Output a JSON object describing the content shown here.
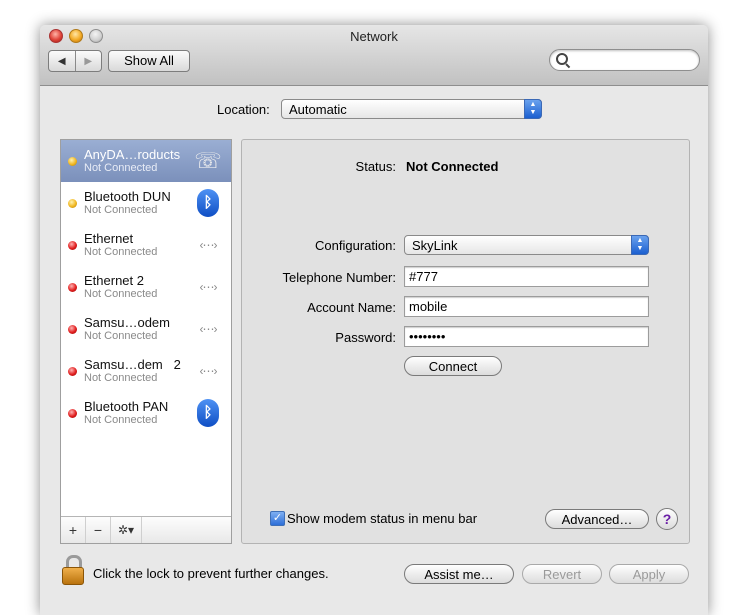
{
  "window": {
    "title": "Network"
  },
  "toolbar": {
    "back": "◀",
    "forward": "▶",
    "show_all": "Show All",
    "search_value": ""
  },
  "location": {
    "label": "Location:",
    "value": "Automatic"
  },
  "services": [
    {
      "name": "AnyDA…roducts",
      "status": "Not Connected",
      "indicator": "yellow",
      "icon": "phone-modem-icon",
      "selected": true
    },
    {
      "name": "Bluetooth DUN",
      "status": "Not Connected",
      "indicator": "yellow",
      "icon": "bluetooth-icon"
    },
    {
      "name": "Ethernet",
      "status": "Not Connected",
      "indicator": "red",
      "icon": "ethernet-icon"
    },
    {
      "name": "Ethernet 2",
      "status": "Not Connected",
      "indicator": "red",
      "icon": "ethernet-icon"
    },
    {
      "name": "Samsu…odem",
      "status": "Not Connected",
      "indicator": "red",
      "icon": "ethernet-icon"
    },
    {
      "name": "Samsu…dem   2",
      "status": "Not Connected",
      "indicator": "red",
      "icon": "ethernet-icon"
    },
    {
      "name": "Bluetooth PAN",
      "status": "Not Connected",
      "indicator": "red",
      "icon": "bluetooth-icon"
    }
  ],
  "sidebar_tools": {
    "add": "+",
    "remove": "−",
    "action": "✲▾"
  },
  "detail": {
    "status_label": "Status:",
    "status_value": "Not Connected",
    "configuration_label": "Configuration:",
    "configuration_value": "SkyLink",
    "telephone_label": "Telephone Number:",
    "telephone_value": "#777",
    "account_label": "Account Name:",
    "account_value": "mobile",
    "password_label": "Password:",
    "password_value": "••••••••",
    "connect_label": "Connect",
    "show_modem_label": "Show modem status in menu bar",
    "show_modem_checked": true,
    "advanced_label": "Advanced…",
    "help_label": "?"
  },
  "footer": {
    "lock_text": "Click the lock to prevent further changes.",
    "assist_label": "Assist me…",
    "revert_label": "Revert",
    "apply_label": "Apply"
  },
  "colors": {
    "indicator_yellow": "#f1b720",
    "indicator_red": "#e11d1d",
    "selection": "#8a9fc8",
    "accent": "#2d6fd8"
  }
}
